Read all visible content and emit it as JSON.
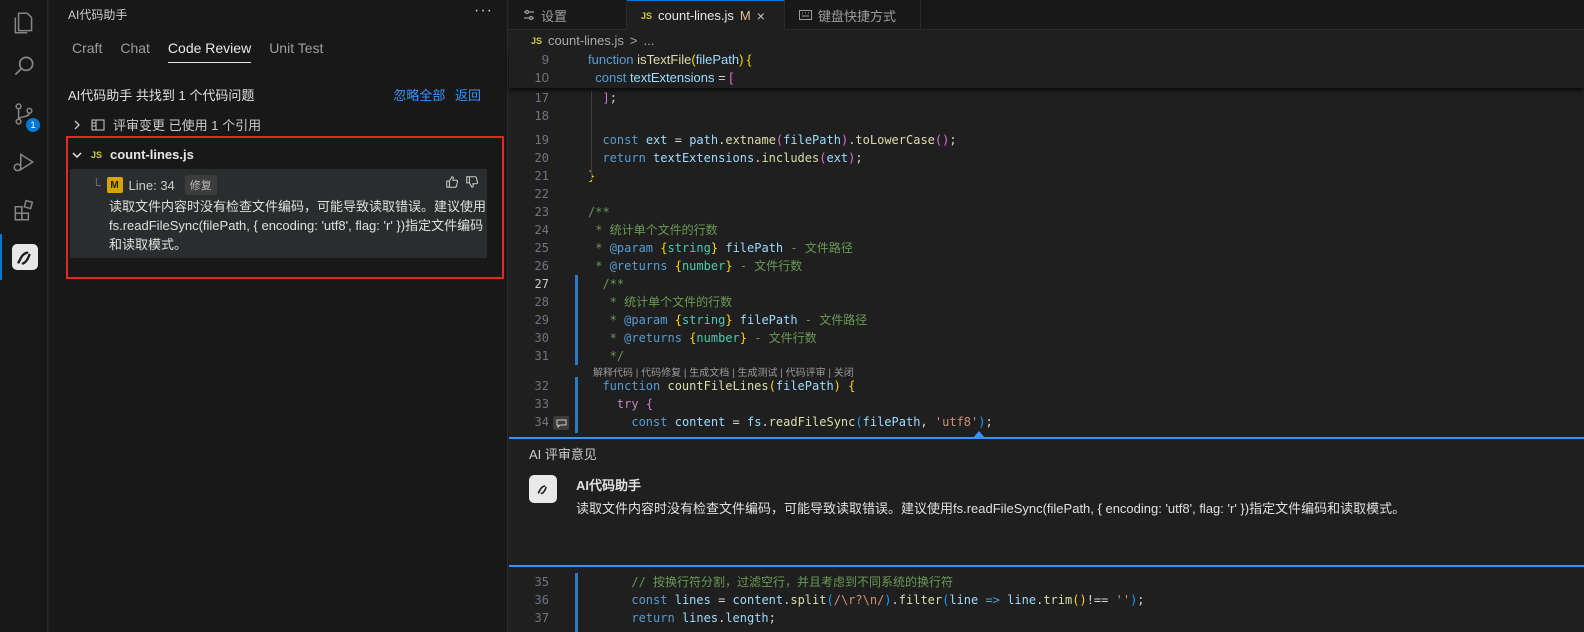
{
  "activity_bar": {
    "items": [
      {
        "name": "explorer-icon"
      },
      {
        "name": "search-icon"
      },
      {
        "name": "source-control-icon",
        "badge": "1"
      },
      {
        "name": "run-debug-icon"
      },
      {
        "name": "extensions-icon"
      },
      {
        "name": "ai-assistant-icon"
      }
    ]
  },
  "sidebar": {
    "title": "AI代码助手",
    "more": "···",
    "tabs": [
      "Craft",
      "Chat",
      "Code Review",
      "Unit Test"
    ],
    "active_tab": "Code Review",
    "summary": "AI代码助手 共找到 1 个代码问题",
    "ignore_all": "忽略全部",
    "back": "返回",
    "review_row": "评审变更 已使用 1 个引用",
    "file": {
      "js_badge": "JS",
      "name": "count-lines.js",
      "issue": {
        "severity_badge": "M",
        "line": "Line: 34",
        "tag": "修复",
        "text": "读取文件内容时没有检查文件编码，可能导致读取错误。建议使用fs.readFileSync(filePath, { encoding: 'utf8', flag: 'r' })指定文件编码和读取模式。"
      }
    }
  },
  "editor": {
    "tabs": [
      {
        "icon": "settings-icon",
        "label": "设置"
      },
      {
        "icon": "js-file-icon",
        "prefix": "JS",
        "label": "count-lines.js",
        "modified": "M",
        "close": "×"
      },
      {
        "icon": "keyboard-icon",
        "label": "键盘快捷方式"
      }
    ],
    "breadcrumb": {
      "prefix": "JS",
      "file": "count-lines.js",
      "sep": ">",
      "tail": "..."
    },
    "codelens": "解释代码 | 代码修复 | 生成文档 | 生成测试 | 代码评审 | 关闭",
    "comment": {
      "title": "AI 评审意见",
      "author": "AI代码助手",
      "body": "读取文件内容时没有检查文件编码，可能导致读取错误。建议使用fs.readFileSync(filePath, { encoding: 'utf8', flag: 'r' })指定文件编码和读取模式。"
    },
    "line_numbers": {
      "l9": "9",
      "l10": "10",
      "l17": "17",
      "l18": "18",
      "l19": "19",
      "l20": "20",
      "l21": "21",
      "l22": "22",
      "l23": "23",
      "l24": "24",
      "l25": "25",
      "l26": "26",
      "l27": "27",
      "l28": "28",
      "l29": "29",
      "l30": "30",
      "l31": "31",
      "l32": "32",
      "l33": "33",
      "l34": "34",
      "l35": "35",
      "l36": "36",
      "l37": "37"
    }
  }
}
